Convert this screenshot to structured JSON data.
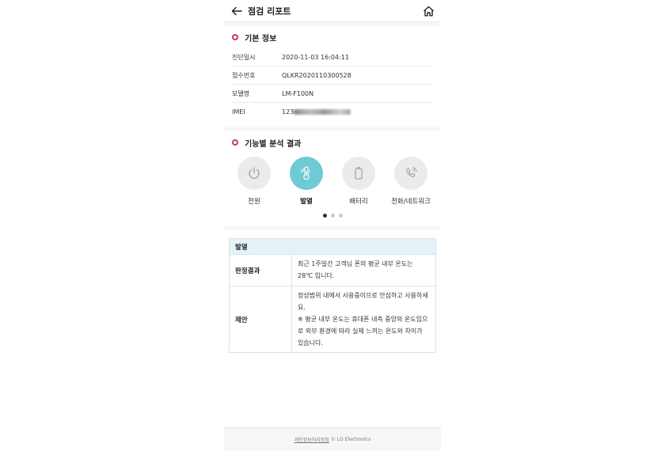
{
  "header": {
    "title": "점검 리포트",
    "back_icon": "arrow-left-icon",
    "home_icon": "home-icon"
  },
  "basic_info": {
    "title": "기본 정보",
    "rows": [
      {
        "label": "진단일시",
        "value": "2020-11-03 16:04:11"
      },
      {
        "label": "접수번호",
        "value": "QLKR2020110300528"
      },
      {
        "label": "모델명",
        "value": "LM-F100N"
      },
      {
        "label": "IMEI",
        "value": "123"
      }
    ]
  },
  "function_results": {
    "title": "기능별 분석 결과",
    "items": [
      {
        "label": "전원",
        "icon": "power-icon",
        "active": false
      },
      {
        "label": "발열",
        "icon": "thermometer-icon",
        "active": true
      },
      {
        "label": "배터리",
        "icon": "battery-icon",
        "active": false
      },
      {
        "label": "전화/네트워크",
        "icon": "phone-signal-icon",
        "active": false
      }
    ],
    "page_indicator": {
      "current": 1,
      "total": 3
    }
  },
  "detail": {
    "header": "발열",
    "rows": [
      {
        "key": "판정결과",
        "value": "최근 1주일간 고객님 폰의 평균 내부 온도는 28℃ 입니다."
      },
      {
        "key": "제안",
        "value": "정상범위 내에서 사용중이므로 안심하고 사용하세요.\n※ 평균 내부 온도는 휴대폰 내측 중앙의 온도임으로 외부 환경에 따라 실제 느끼는 온도와 차이가 있습니다."
      }
    ]
  },
  "footer": {
    "privacy_link": "개인정보처리방침",
    "copyright": "© LG Electronics"
  },
  "colors": {
    "accent_pink": "#c5367c",
    "active_teal": "#6ecad5",
    "detail_header_bg": "#e3f3f8"
  }
}
